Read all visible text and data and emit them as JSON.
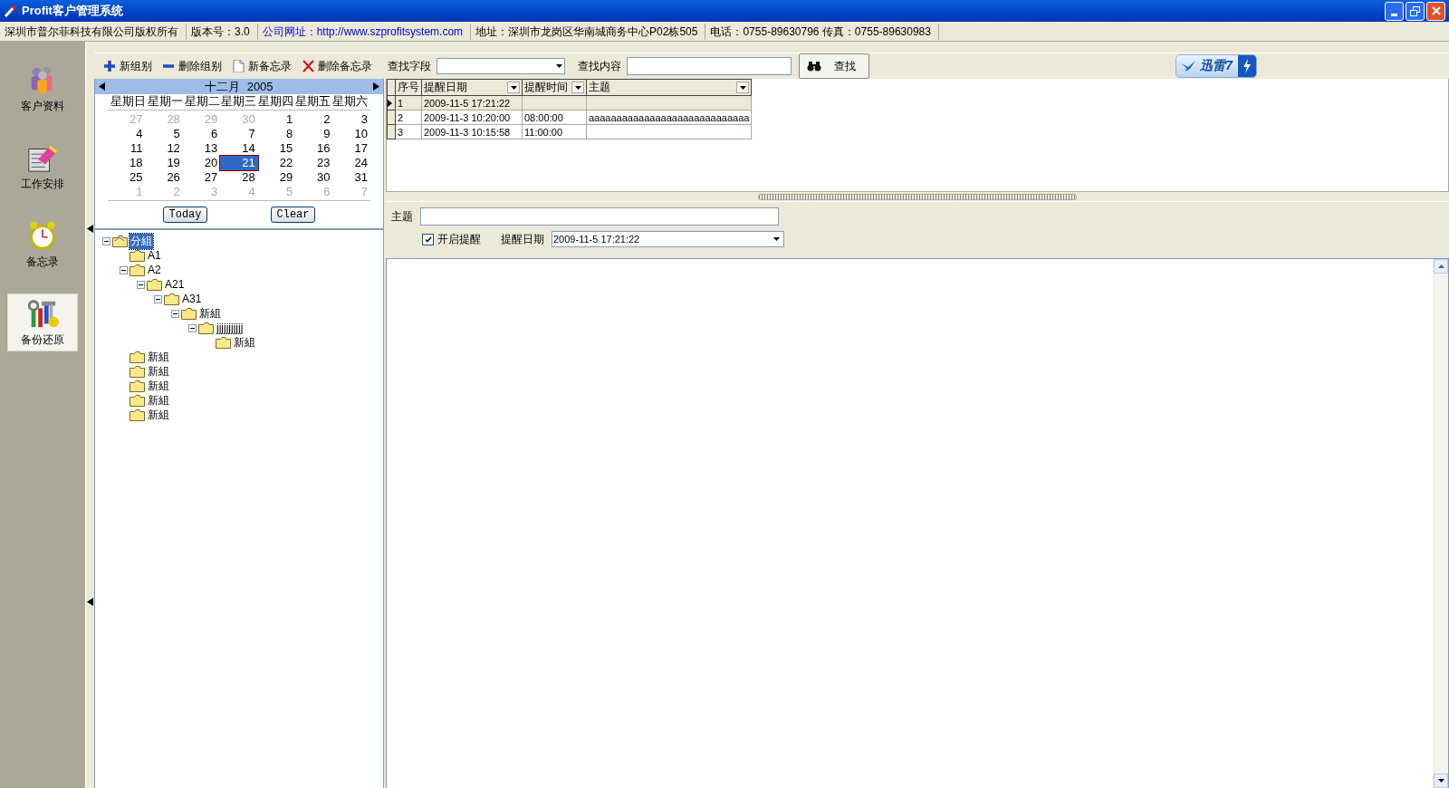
{
  "window": {
    "title": "Profit客户管理系统"
  },
  "info_bar": [
    {
      "text": "深圳市普尔菲科技有限公司版权所有",
      "kind": "plain"
    },
    {
      "text": "版本号：3.0",
      "kind": "plain"
    },
    {
      "text": "公司网址：http://www.szprofitsystem.com",
      "kind": "link"
    },
    {
      "text": "地址：深圳市龙岗区华南城商务中心P02栋505",
      "kind": "plain"
    },
    {
      "text": "电话：0755-89630796 传真：0755-89630983",
      "kind": "plain"
    }
  ],
  "sidebar": {
    "items": [
      {
        "label": "客户资料",
        "selected": false
      },
      {
        "label": "工作安排",
        "selected": false
      },
      {
        "label": "备忘录",
        "selected": false
      },
      {
        "label": "备份还原",
        "selected": true
      }
    ]
  },
  "toolbar": {
    "buttons": [
      {
        "label": "新组别"
      },
      {
        "label": "删除组别"
      },
      {
        "label": "新备忘录"
      },
      {
        "label": "删除备忘录"
      }
    ],
    "search_field_label": "查找字段",
    "search_content_label": "查找内容",
    "search_button": "查找"
  },
  "badge": {
    "text": "迅雷7"
  },
  "calendar": {
    "month": "十二月",
    "year": "2005",
    "weekdays": [
      "星期日",
      "星期一",
      "星期二",
      "星期三",
      "星期四",
      "星期五",
      "星期六"
    ],
    "weeks": [
      [
        {
          "d": "27",
          "muted": true,
          "selected": false
        },
        {
          "d": "28",
          "muted": true,
          "selected": false
        },
        {
          "d": "29",
          "muted": true,
          "selected": false
        },
        {
          "d": "30",
          "muted": true,
          "selected": false
        },
        {
          "d": "1",
          "muted": false,
          "selected": false
        },
        {
          "d": "2",
          "muted": false,
          "selected": false
        },
        {
          "d": "3",
          "muted": false,
          "selected": false
        }
      ],
      [
        {
          "d": "4",
          "muted": false,
          "selected": false
        },
        {
          "d": "5",
          "muted": false,
          "selected": false
        },
        {
          "d": "6",
          "muted": false,
          "selected": false
        },
        {
          "d": "7",
          "muted": false,
          "selected": false
        },
        {
          "d": "8",
          "muted": false,
          "selected": false
        },
        {
          "d": "9",
          "muted": false,
          "selected": false
        },
        {
          "d": "10",
          "muted": false,
          "selected": false
        }
      ],
      [
        {
          "d": "11",
          "muted": false,
          "selected": false
        },
        {
          "d": "12",
          "muted": false,
          "selected": false
        },
        {
          "d": "13",
          "muted": false,
          "selected": false
        },
        {
          "d": "14",
          "muted": false,
          "selected": false
        },
        {
          "d": "15",
          "muted": false,
          "selected": false
        },
        {
          "d": "16",
          "muted": false,
          "selected": false
        },
        {
          "d": "17",
          "muted": false,
          "selected": false
        }
      ],
      [
        {
          "d": "18",
          "muted": false,
          "selected": false
        },
        {
          "d": "19",
          "muted": false,
          "selected": false
        },
        {
          "d": "20",
          "muted": false,
          "selected": false
        },
        {
          "d": "21",
          "muted": false,
          "selected": true
        },
        {
          "d": "22",
          "muted": false,
          "selected": false
        },
        {
          "d": "23",
          "muted": false,
          "selected": false
        },
        {
          "d": "24",
          "muted": false,
          "selected": false
        }
      ],
      [
        {
          "d": "25",
          "muted": false,
          "selected": false
        },
        {
          "d": "26",
          "muted": false,
          "selected": false
        },
        {
          "d": "27",
          "muted": false,
          "selected": false
        },
        {
          "d": "28",
          "muted": false,
          "selected": false
        },
        {
          "d": "29",
          "muted": false,
          "selected": false
        },
        {
          "d": "30",
          "muted": false,
          "selected": false
        },
        {
          "d": "31",
          "muted": false,
          "selected": false
        }
      ],
      [
        {
          "d": "1",
          "muted": true,
          "selected": false
        },
        {
          "d": "2",
          "muted": true,
          "selected": false
        },
        {
          "d": "3",
          "muted": true,
          "selected": false
        },
        {
          "d": "4",
          "muted": true,
          "selected": false
        },
        {
          "d": "5",
          "muted": true,
          "selected": false
        },
        {
          "d": "6",
          "muted": true,
          "selected": false
        },
        {
          "d": "7",
          "muted": true,
          "selected": false
        }
      ]
    ],
    "buttons": [
      "Today",
      "Clear"
    ]
  },
  "tree": [
    {
      "label": "分組",
      "selected": true,
      "expanded": true,
      "children": [
        {
          "label": "A1",
          "selected": false
        },
        {
          "label": "A2",
          "selected": false,
          "expanded": true,
          "children": [
            {
              "label": "A21",
              "selected": false,
              "expanded": true,
              "children": [
                {
                  "label": "A31",
                  "selected": false,
                  "expanded": true,
                  "children": [
                    {
                      "label": "新組",
                      "selected": false,
                      "expanded": true,
                      "children": [
                        {
                          "label": "jjjjjjjjjjj",
                          "selected": false,
                          "expanded": true,
                          "children": [
                            {
                              "label": "新組",
                              "selected": false
                            }
                          ]
                        }
                      ]
                    }
                  ]
                }
              ]
            }
          ]
        },
        {
          "label": "新組",
          "selected": false
        },
        {
          "label": "新組",
          "selected": false
        },
        {
          "label": "新組",
          "selected": false
        },
        {
          "label": "新組",
          "selected": false
        },
        {
          "label": "新組",
          "selected": false
        }
      ]
    }
  ],
  "table": {
    "columns": [
      {
        "label": "序号",
        "dropdown": false
      },
      {
        "label": "提醒日期",
        "dropdown": true
      },
      {
        "label": "提醒时间",
        "dropdown": true
      },
      {
        "label": "主题",
        "dropdown": true
      }
    ],
    "rows": [
      {
        "cells": [
          "1",
          "2009-11-5 17:21:22",
          "",
          ""
        ],
        "selected": true
      },
      {
        "cells": [
          "2",
          "2009-11-3 10:20:00",
          "08:00:00",
          "aaaaaaaaaaaaaaaaaaaaaaaaaaaaa"
        ],
        "selected": false
      },
      {
        "cells": [
          "3",
          "2009-11-3 10:15:58",
          "11:00:00",
          ""
        ],
        "selected": false
      }
    ]
  },
  "form": {
    "subject_label": "主题",
    "reminder_label": "开启提醒",
    "reminder_checked": true,
    "date_label": "提醒日期",
    "date_value": "2009-11-5 17:21:22"
  }
}
